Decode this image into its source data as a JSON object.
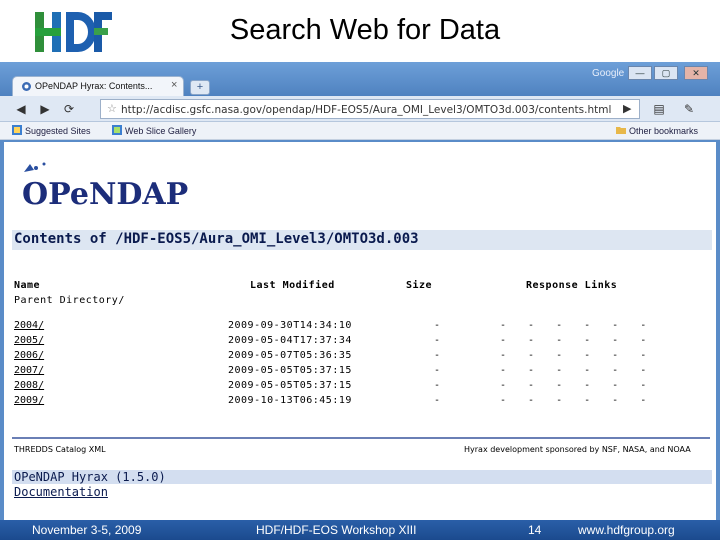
{
  "slide": {
    "title": "Search Web for Data",
    "footer": {
      "date": "November 3-5, 2009",
      "event": "HDF/HDF-EOS Workshop XIII",
      "page": "14",
      "site": "www.hdfgroup.org"
    }
  },
  "browser": {
    "tab_label": "OPeNDAP Hyrax: Contents...",
    "tab_close": "×",
    "new_tab": "+",
    "brand": "Google",
    "window_buttons": [
      "—",
      "▢",
      "✕"
    ],
    "url": "http://acdisc.gsfc.nasa.gov/opendap/HDF-EOS5/Aura_OMI_Level3/OMTO3d.003/contents.html",
    "bookmarks": {
      "suggested": "Suggested Sites",
      "gallery": "Web Slice Gallery",
      "other": "Other bookmarks"
    }
  },
  "page": {
    "logo_text": "OPeNDAP",
    "heading": "Contents of /HDF-EOS5/Aura_OMI_Level3/OMTO3d.003",
    "columns": {
      "name": "Name",
      "modified": "Last Modified",
      "size": "Size",
      "response": "Response Links"
    },
    "parent": "Parent Directory/",
    "rows": [
      {
        "name": "2004/",
        "modified": "2009-09-30T14:34:10",
        "size": "-",
        "links": "- - - - - -"
      },
      {
        "name": "2005/",
        "modified": "2009-05-04T17:37:34",
        "size": "-",
        "links": "- - - - - -"
      },
      {
        "name": "2006/",
        "modified": "2009-05-07T05:36:35",
        "size": "-",
        "links": "- - - - - -"
      },
      {
        "name": "2007/",
        "modified": "2009-05-05T05:37:15",
        "size": "-",
        "links": "- - - - - -"
      },
      {
        "name": "2008/",
        "modified": "2009-05-05T05:37:15",
        "size": "-",
        "links": "- - - - - -"
      },
      {
        "name": "2009/",
        "modified": "2009-10-13T06:45:19",
        "size": "-",
        "links": "- - - - - -"
      }
    ],
    "footer_left": "THREDDS Catalog XML",
    "footer_right": "Hyrax development sponsored by NSF, NASA, and NOAA",
    "hyrax_version": "OPeNDAP Hyrax (1.5.0)",
    "documentation": "Documentation"
  }
}
